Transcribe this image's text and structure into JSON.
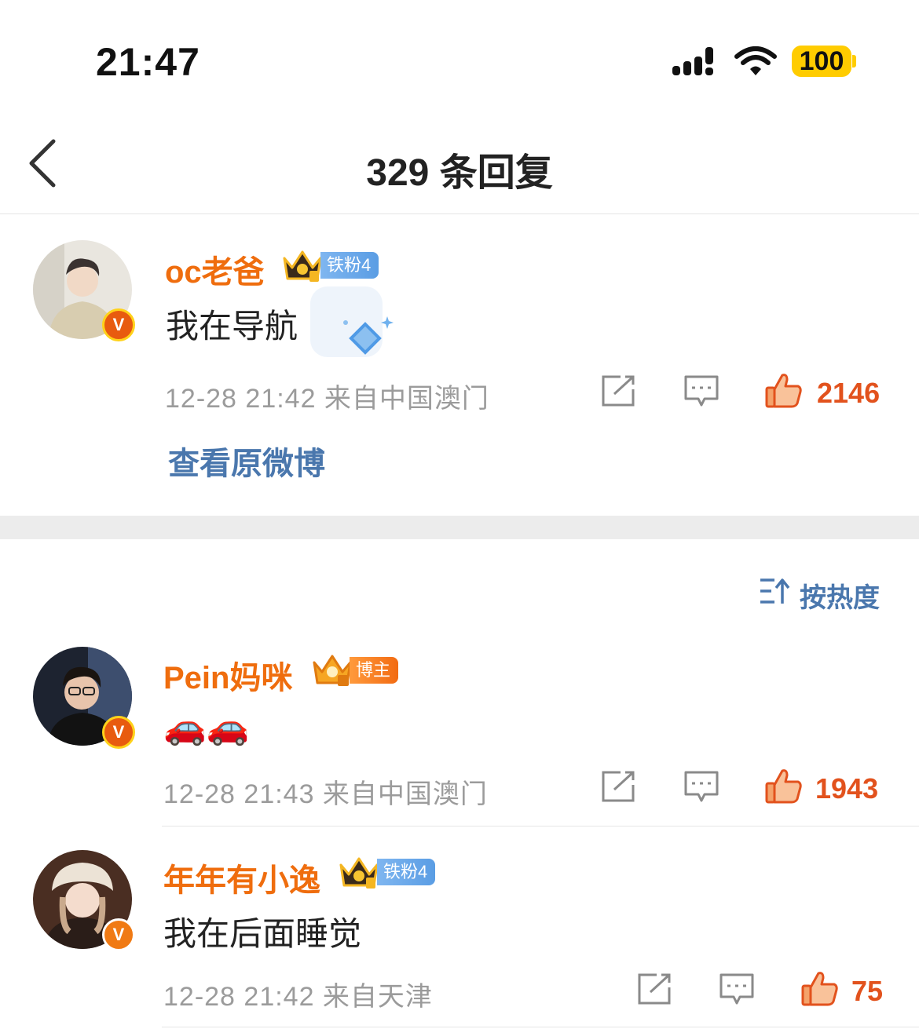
{
  "status_bar": {
    "time": "21:47",
    "battery": "100"
  },
  "nav": {
    "title": "329 条回复"
  },
  "top_comment": {
    "username": "oc老爸",
    "fan_badge": "铁粉4",
    "text": "我在导航",
    "meta": "12-28 21:42  来自中国澳门",
    "likes": "2146",
    "view_original": "查看原微博"
  },
  "sort": {
    "label": "按热度"
  },
  "replies": [
    {
      "username": "Pein妈咪",
      "badge": "博主",
      "text": "🚗🚗",
      "meta": "12-28 21:43  来自中国澳门",
      "likes": "1943"
    },
    {
      "username": "年年有小逸",
      "badge": "铁粉4",
      "text": "我在后面睡觉",
      "meta": "12-28 21:42  来自天津",
      "likes": "75"
    }
  ],
  "colors": {
    "username": "#ef6d0e",
    "link": "#4a77ad",
    "like": "#e2521d",
    "meta": "#9b9b9b"
  }
}
